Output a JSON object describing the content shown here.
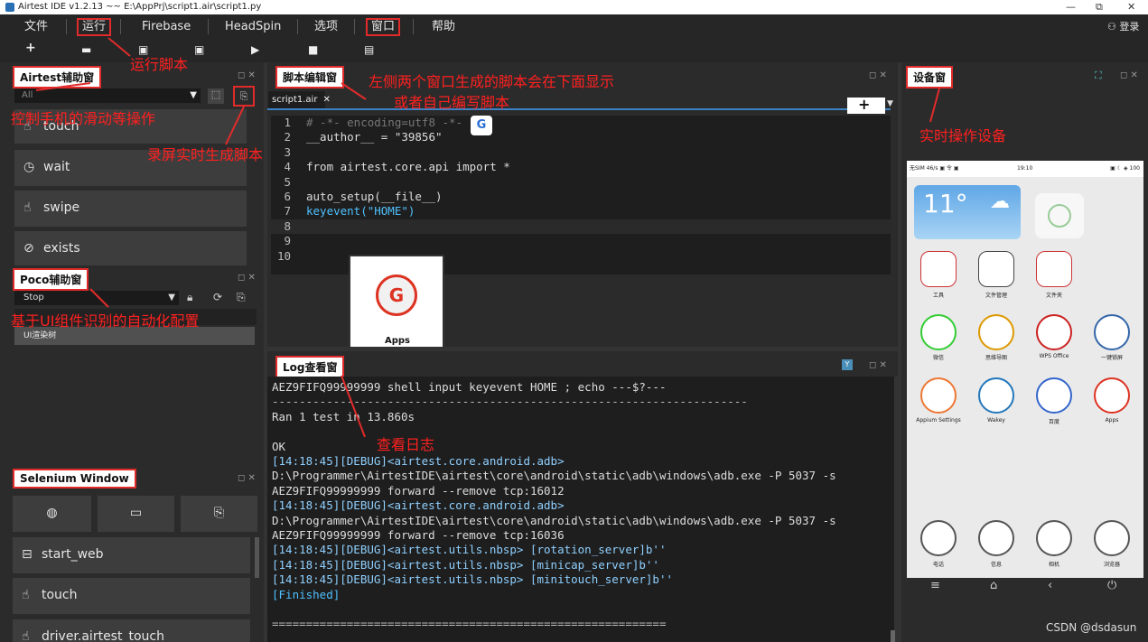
{
  "window": {
    "title": "Airtest IDE v1.2.13 ~~ E:\\AppPrj\\script1.air\\script1.py",
    "minimize": "—",
    "restore": "⧉",
    "close": "✕"
  },
  "menu": [
    "文件",
    "运行",
    "Firebase",
    "HeadSpin",
    "选项",
    "窗口",
    "帮助"
  ],
  "login": "登录",
  "toolbar_icons": [
    "plus-icon",
    "folder-icon",
    "save-icon",
    "save-as-icon",
    "play-icon",
    "stop-icon",
    "screen-icon"
  ],
  "airtest_panel": {
    "title": "Airtest辅助窗",
    "filter": "All",
    "buttons": [
      "touch",
      "wait",
      "swipe",
      "exists"
    ]
  },
  "poco_panel": {
    "title": "Poco辅助窗",
    "mode": "Stop",
    "tree_root": "UI渲染树"
  },
  "selenium_panel": {
    "title": "Selenium Window",
    "buttons": [
      "start_web",
      "touch",
      "driver.airtest_touch"
    ]
  },
  "editor": {
    "title": "脚本编辑窗",
    "tab": "script1.air",
    "lines": [
      "# -*- encoding=utf8 -*-",
      "__author__ = \"39856\"",
      "",
      "from airtest.core.api import *",
      "",
      "auto_setup(__file__)",
      "keyevent(\"HOME\")",
      "",
      "",
      ""
    ],
    "thumb_label": "Apps"
  },
  "log_panel": {
    "title": "Log查看窗",
    "lines": [
      "AEZ9FIFQ99999999 shell input keyevent HOME ; echo ---$?---",
      "----------------------------------------------------------------------",
      "Ran 1 test in 13.860s",
      "",
      "OK",
      "[14:18:45][DEBUG]<airtest.core.android.adb>",
      "D:\\Programmer\\AirtestIDE\\airtest\\core\\android\\static\\adb\\windows\\adb.exe -P 5037 -s",
      "AEZ9FIFQ99999999 forward --remove tcp:16012",
      "[14:18:45][DEBUG]<airtest.core.android.adb>",
      "D:\\Programmer\\AirtestIDE\\airtest\\core\\android\\static\\adb\\windows\\adb.exe -P 5037 -s",
      "AEZ9FIFQ99999999 forward --remove tcp:16036",
      "[14:18:45][DEBUG]<airtest.utils.nbsp> [rotation_server]b''",
      "[14:18:45][DEBUG]<airtest.utils.nbsp> [minicap_server]b''",
      "[14:18:45][DEBUG]<airtest.utils.nbsp> [minitouch_server]b''",
      "[Finished]",
      "",
      "=========================================================="
    ]
  },
  "device_panel": {
    "title": "设备窗",
    "status_left": "无SIM 46/s ▣ 令 ▣",
    "status_time": "19:10",
    "status_right": "▣ ☾ ◈ 100",
    "weather_temp": "11°",
    "apps": [
      [
        "工具",
        "文件管理",
        "文件夹"
      ],
      [
        "微信",
        "思维导图",
        "WPS Office",
        "一键锁屏"
      ],
      [
        "Appium Settings",
        "Wakey",
        "百度",
        "Apps"
      ],
      [
        "电话",
        "信息",
        "相机",
        "浏览器"
      ]
    ]
  },
  "annotations": {
    "run": "运行脚本",
    "control": "控制手机的滑动等操作",
    "record": "录屏实时生成脚本",
    "ui": "基于UI组件识别的自动化配置",
    "script1": "左侧两个窗口生成的脚本会在下面显示",
    "script2": "或者自己编写脚本",
    "log": "查看日志",
    "device": "实时操作设备"
  },
  "watermark": "CSDN @dsdasun"
}
